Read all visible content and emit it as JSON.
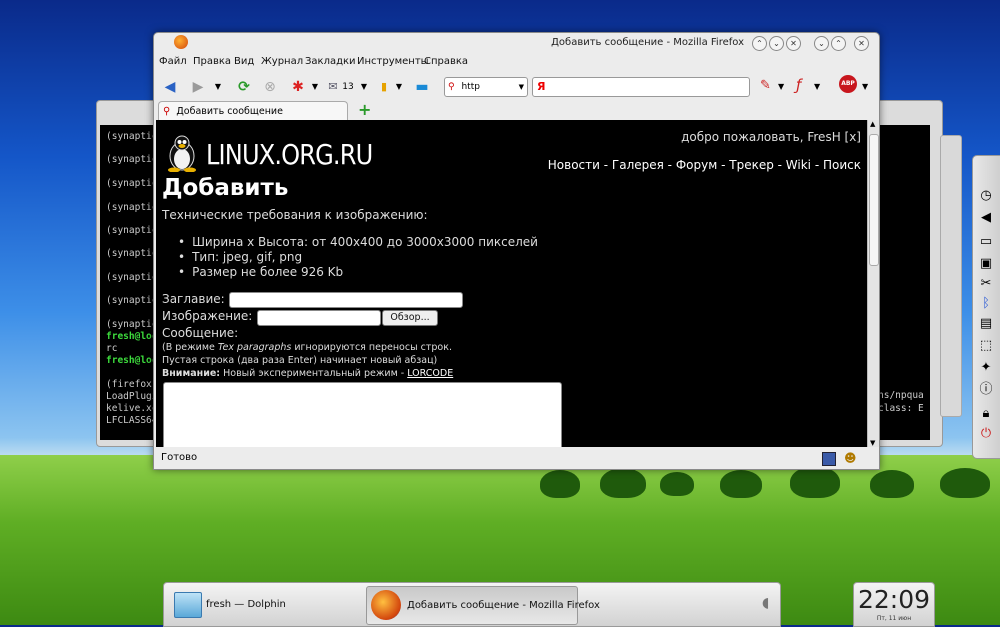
{
  "window": {
    "title": "Добавить сообщение - Mozilla Firefox"
  },
  "menu": [
    "Файл",
    "Правка",
    "Вид",
    "Журнал",
    "Закладки",
    "Инструменты",
    "Справка"
  ],
  "toolbar": {
    "mail_count": "13",
    "url_prefix": "http",
    "search_engine_glyph": "Я"
  },
  "tab": {
    "label": "Добавить сообщение",
    "new_tab_glyph": "+"
  },
  "page": {
    "logo_text": "LINUX.ORG.RU",
    "welcome": "добро пожаловать, FresH [x]",
    "nav": [
      "Новости",
      "Галерея",
      "Форум",
      "Трекер",
      "Wiki",
      "Поиск"
    ],
    "nav_sep": " - ",
    "heading": "Добавить",
    "requirements_title": "Технические требования к изображению:",
    "requirements": [
      "Ширина x Высота: от 400x400 до 3000x3000 пикселей",
      "Тип: jpeg, gif, png",
      "Размер не более 926 Kb"
    ],
    "title_label": "Заглавие:",
    "image_label": "Изображение:",
    "browse_button": "Обзор...",
    "message_label": "Сообщение:",
    "note1_prefix": "(В режиме ",
    "note1_em": "Tex paragraphs",
    "note1_suffix": " игнорируются переносы строк.",
    "note2": "Пустая строка (два раза Enter) начинает новый абзац)",
    "warning_bold": "Внимание:",
    "warning_text": " Новый экспериментальный режим - ",
    "warning_link": "LORCODE"
  },
  "status": {
    "text": "Готово"
  },
  "terminal": {
    "lines": [
      "(synaptic",
      "(synaptic",
      "(synaptic",
      "(synaptic",
      "(synaptic",
      "(synaptic",
      "(synaptic",
      "(synaptic",
      "(synaptic",
      "fresh@loc",
      "rc",
      "fresh@loc",
      "(firefox",
      "LoadPlugi",
      "kelive.xc",
      "LFCLASS64"
    ],
    "right_lines": [
      "ns/npqua",
      "class: E"
    ]
  },
  "taskbar": {
    "tasks": [
      "fresh — Dolphin",
      "Добавить сообщение - Mozilla Firefox"
    ]
  },
  "clock": {
    "time": "22:09",
    "date": "Пт, 11 июн"
  },
  "colors": {
    "page_bg": "#000000",
    "page_text": "#dddddd",
    "link": "#ffffff"
  }
}
